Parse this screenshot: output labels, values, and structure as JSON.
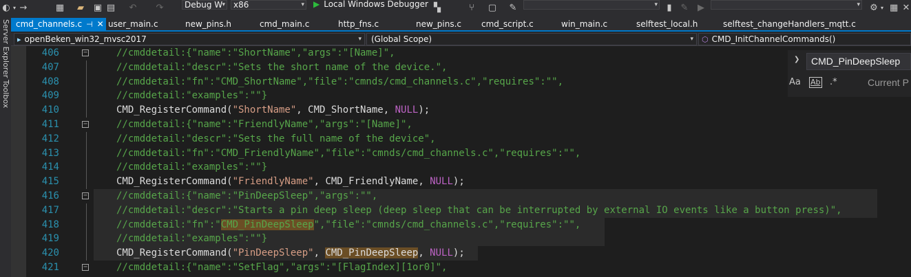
{
  "toolbar": {
    "configuration": "Debug W",
    "platform": "x86",
    "debugger_label": "Local Windows Debugger"
  },
  "side_panel": {
    "server_explorer": "Server Explorer",
    "toolbox": "Toolbox"
  },
  "tabs": [
    {
      "label": "cmd_channels.c",
      "active": true
    },
    {
      "label": "user_main.c"
    },
    {
      "label": "new_pins.h"
    },
    {
      "label": "cmd_main.c"
    },
    {
      "label": "http_fns.c"
    },
    {
      "label": "new_pins.c"
    },
    {
      "label": "cmd_script.c"
    },
    {
      "label": "win_main.c"
    },
    {
      "label": "selftest_local.h"
    },
    {
      "label": "selftest_changeHandlers_mqtt.c"
    }
  ],
  "navbar": {
    "project": "openBeken_win32_mvsc2017",
    "scope": "(Global Scope)",
    "member": "CMD_InitChannelCommands()"
  },
  "find": {
    "query": "CMD_PinDeepSleep",
    "scope_label": "Current P",
    "match_case_icon": "Aa",
    "whole_word_icon": "Ab"
  },
  "editor": {
    "lines": [
      {
        "number": "406",
        "text": "//cmddetail:{\"name\":\"ShortName\",\"args\":\"[Name]\","
      },
      {
        "number": "407",
        "text": "//cmddetail:\"descr\":\"Sets the short name of the device.\","
      },
      {
        "number": "408",
        "text": "//cmddetail:\"fn\":\"CMD_ShortName\",\"file\":\"cmnds/cmd_channels.c\",\"requires\":\"\","
      },
      {
        "number": "409",
        "text": "//cmddetail:\"examples\":\"\"}"
      },
      {
        "number": "410",
        "text": "CMD_RegisterCommand(\"ShortName\", CMD_ShortName, NULL);"
      },
      {
        "number": "411",
        "text": "//cmddetail:{\"name\":\"FriendlyName\",\"args\":\"[Name]\","
      },
      {
        "number": "412",
        "text": "//cmddetail:\"descr\":\"Sets the full name of the device\","
      },
      {
        "number": "413",
        "text": "//cmddetail:\"fn\":\"CMD_FriendlyName\",\"file\":\"cmnds/cmd_channels.c\",\"requires\":\"\","
      },
      {
        "number": "414",
        "text": "//cmddetail:\"examples\":\"\"}"
      },
      {
        "number": "415",
        "text": "CMD_RegisterCommand(\"FriendlyName\", CMD_FriendlyName, NULL);"
      },
      {
        "number": "416",
        "text": "//cmddetail:{\"name\":\"PinDeepSleep\",\"args\":\"\","
      },
      {
        "number": "417",
        "text": "//cmddetail:\"descr\":\"Starts a pin deep sleep (deep sleep that can be interrupted by external IO events like a button press)\","
      },
      {
        "number": "418",
        "text": "//cmddetail:\"fn\":\"CMD_PinDeepSleep\",\"file\":\"cmnds/cmd_channels.c\",\"requires\":\"\","
      },
      {
        "number": "419",
        "text": "//cmddetail:\"examples\":\"\"}"
      },
      {
        "number": "420",
        "text": "CMD_RegisterCommand(\"PinDeepSleep\", CMD_PinDeepSleep, NULL);"
      },
      {
        "number": "421",
        "text": "//cmddetail:{\"name\":\"SetFlag\",\"args\":\"[FlagIndex][1or0]\","
      }
    ]
  },
  "colors": {
    "accent": "#007acc",
    "comment": "#57a64a",
    "string": "#d69d85",
    "macro": "#bd63c5",
    "line_number": "#2b91af",
    "highlight": "#6b4e25"
  }
}
